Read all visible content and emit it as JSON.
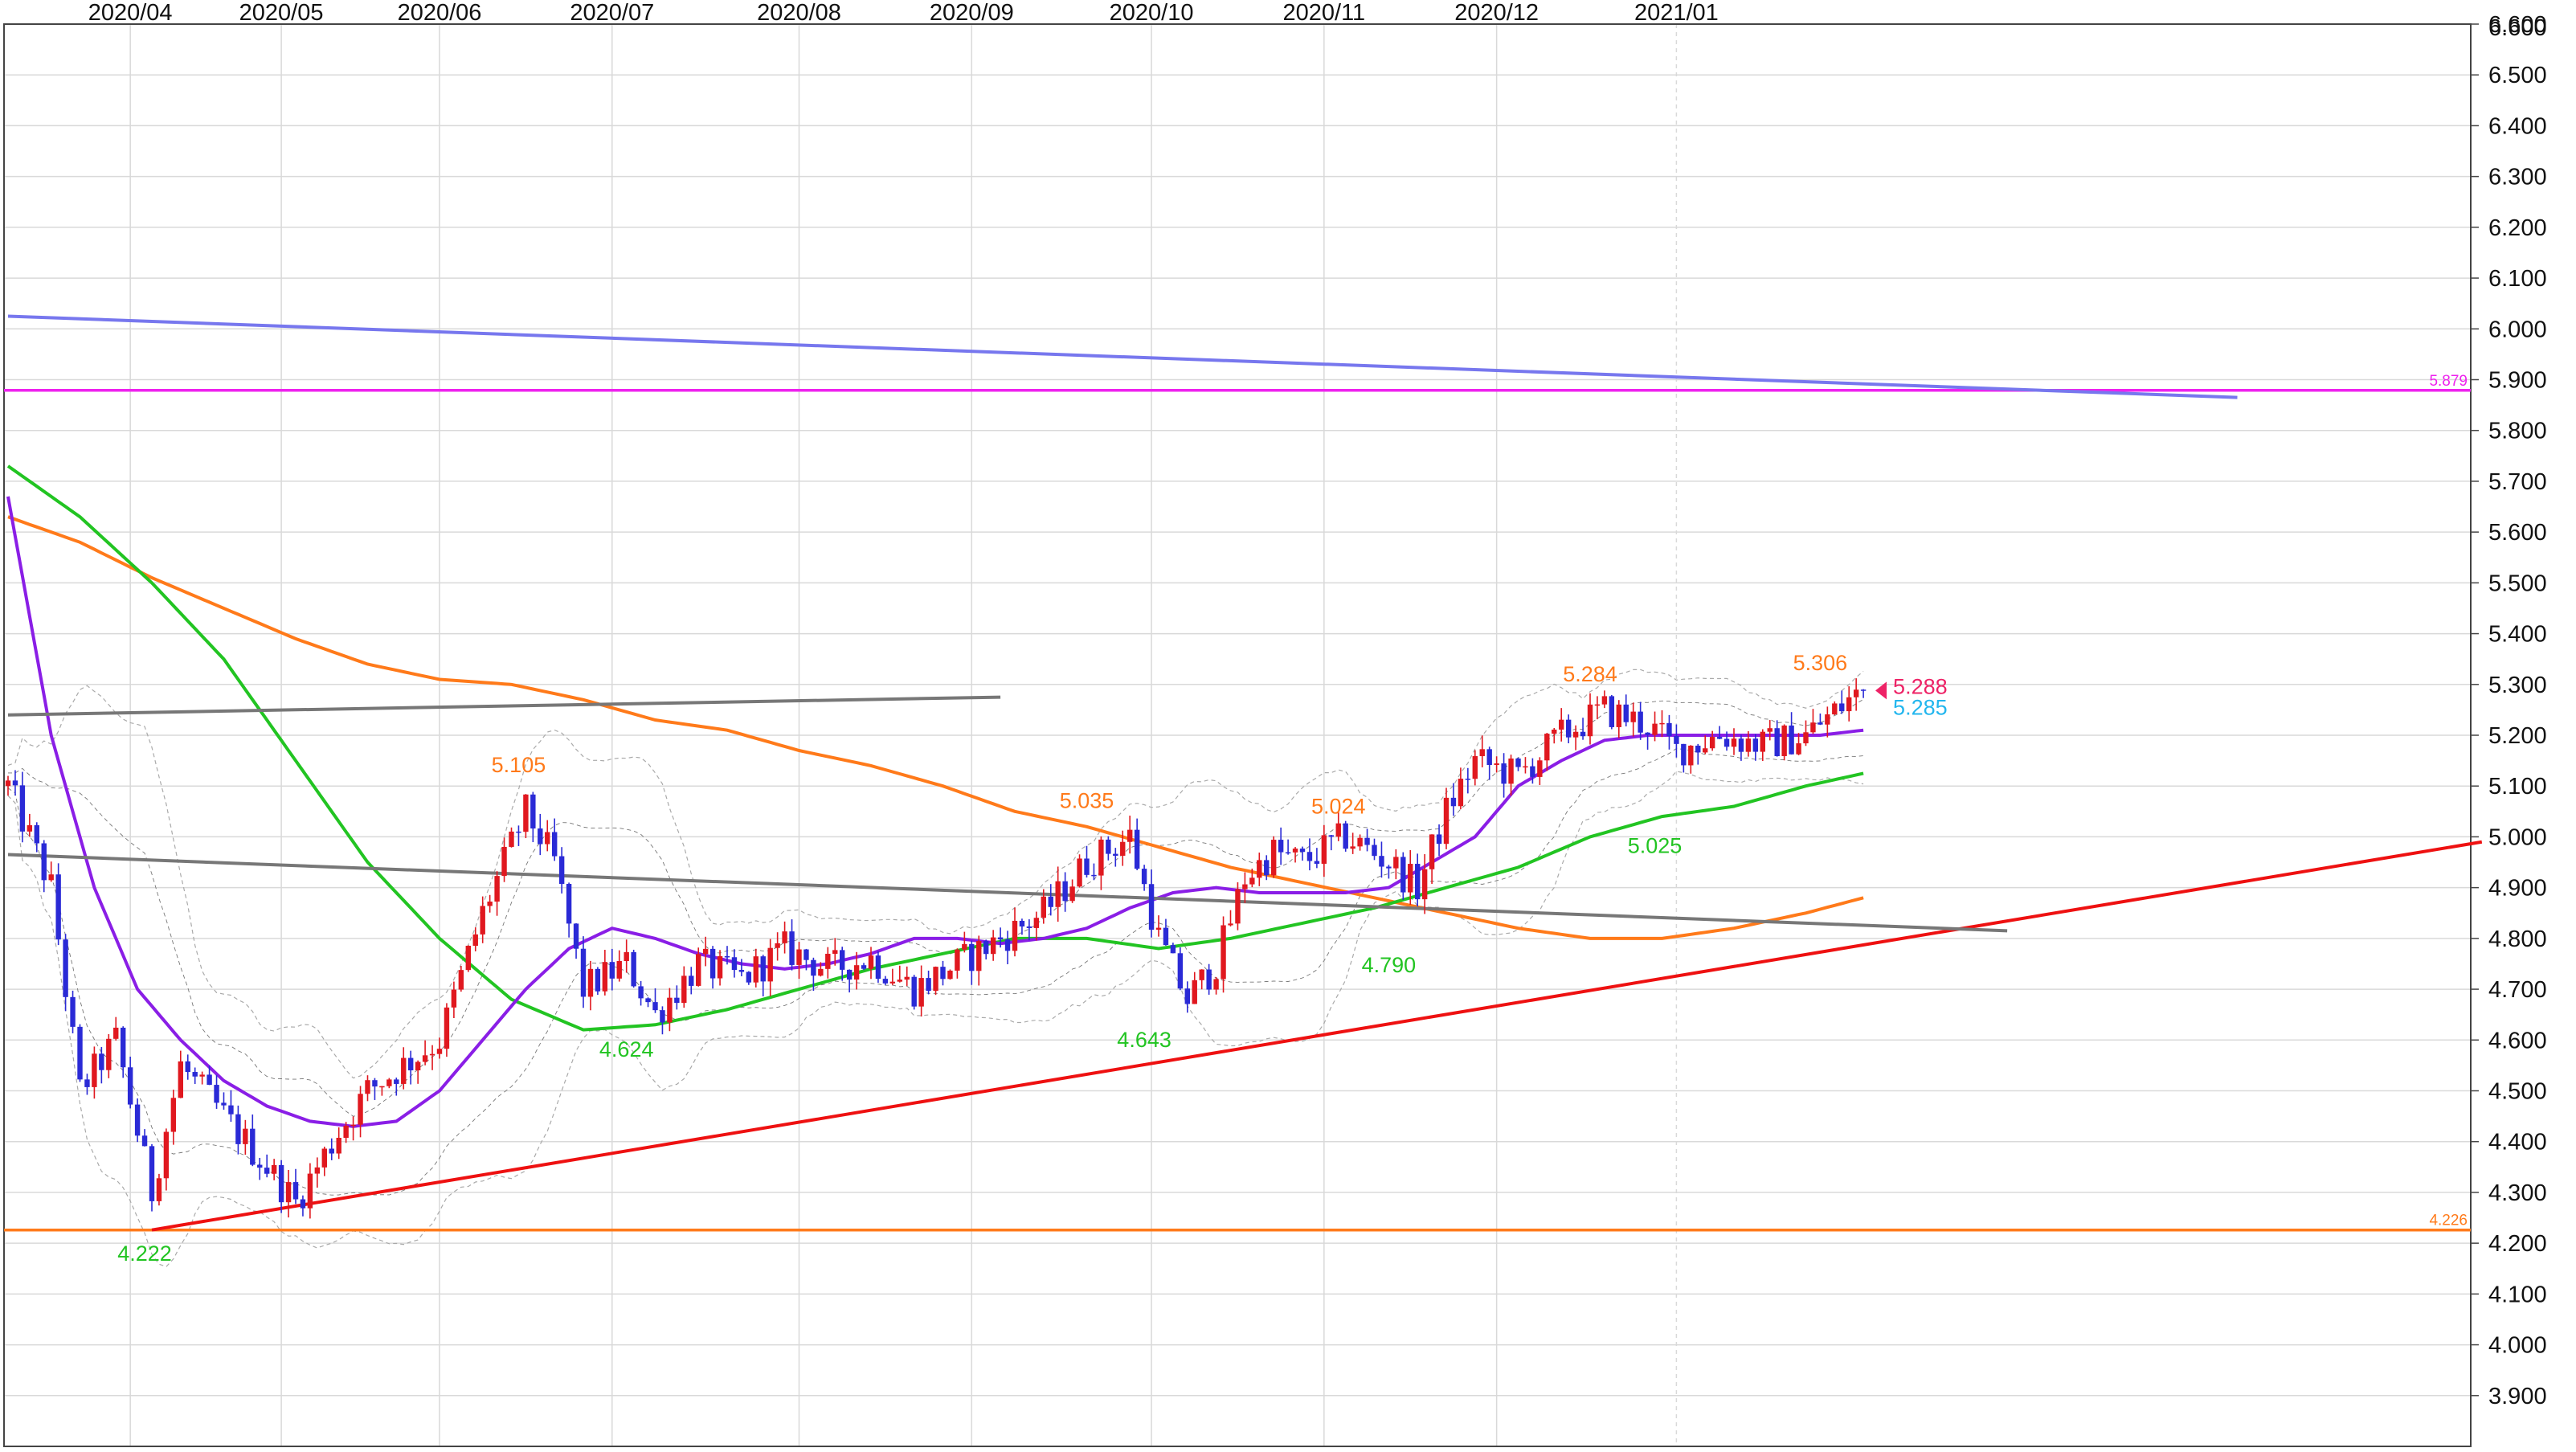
{
  "chart_data": {
    "type": "candlestick",
    "x_axis": {
      "ticks": [
        "2020/04",
        "2020/05",
        "2020/06",
        "2020/07",
        "2020/08",
        "2020/09",
        "2020/10",
        "2020/11",
        "2020/12",
        "2021/01"
      ]
    },
    "y_axis": {
      "range": [
        3.8,
        6.6
      ],
      "ticks": [
        "3.900",
        "4.000",
        "4.100",
        "4.200",
        "4.300",
        "4.400",
        "4.500",
        "4.600",
        "4.700",
        "4.800",
        "4.900",
        "5.000",
        "5.100",
        "5.200",
        "5.300",
        "5.400",
        "5.500",
        "5.600",
        "5.700",
        "5.800",
        "5.900",
        "6.000",
        "6.100",
        "6.200",
        "6.300",
        "6.400",
        "6.500",
        "6.600"
      ]
    },
    "grid": true,
    "colors": {
      "up_candle": "#e0181f",
      "down_candle": "#2a2ad6",
      "ma_short": "#8a1ee6",
      "ma_mid": "#22c422",
      "ma_long": "#ff7a1a",
      "uptrend_line": "#ee1111",
      "downtrend_line": "#7777ee",
      "resistance_line": "#ee22ee",
      "support_line": "#ff7a1a",
      "gray_line": "#777777",
      "last_price": "#ee2266",
      "current_ma": "#22b6ee"
    },
    "horizontal_lines": [
      {
        "value": 5.879,
        "label": "5.879",
        "color": "#ee22ee"
      },
      {
        "value": 4.226,
        "label": "4.226",
        "color": "#ff7a1a"
      }
    ],
    "trend_lines": [
      {
        "from": [
          0.0,
          6.025
        ],
        "to": [
          310.0,
          5.865
        ],
        "color": "#7777ee"
      },
      {
        "from": [
          20.0,
          4.226
        ],
        "to": [
          344.0,
          4.99
        ],
        "color": "#ee1111"
      },
      {
        "from": [
          0.0,
          5.24
        ],
        "to": [
          138.0,
          5.275
        ],
        "color": "#777777"
      },
      {
        "from": [
          0.0,
          4.965
        ],
        "to": [
          278.0,
          4.815
        ],
        "color": "#777777"
      }
    ],
    "ma_short": [
      [
        0,
        5.67
      ],
      [
        6,
        5.2
      ],
      [
        12,
        4.9
      ],
      [
        18,
        4.7
      ],
      [
        24,
        4.6
      ],
      [
        30,
        4.52
      ],
      [
        36,
        4.47
      ],
      [
        42,
        4.44
      ],
      [
        48,
        4.43
      ],
      [
        54,
        4.44
      ],
      [
        60,
        4.5
      ],
      [
        66,
        4.6
      ],
      [
        72,
        4.7
      ],
      [
        78,
        4.78
      ],
      [
        84,
        4.82
      ],
      [
        90,
        4.8
      ],
      [
        96,
        4.77
      ],
      [
        102,
        4.75
      ],
      [
        108,
        4.74
      ],
      [
        114,
        4.75
      ],
      [
        120,
        4.77
      ],
      [
        126,
        4.8
      ],
      [
        132,
        4.8
      ],
      [
        138,
        4.79
      ],
      [
        144,
        4.8
      ],
      [
        150,
        4.82
      ],
      [
        156,
        4.86
      ],
      [
        162,
        4.89
      ],
      [
        168,
        4.9
      ],
      [
        174,
        4.89
      ],
      [
        180,
        4.89
      ],
      [
        186,
        4.89
      ],
      [
        192,
        4.9
      ],
      [
        198,
        4.95
      ],
      [
        204,
        5.0
      ],
      [
        210,
        5.1
      ],
      [
        216,
        5.15
      ],
      [
        222,
        5.19
      ],
      [
        228,
        5.2
      ],
      [
        234,
        5.2
      ],
      [
        240,
        5.2
      ],
      [
        246,
        5.2
      ],
      [
        252,
        5.2
      ],
      [
        258,
        5.21
      ]
    ],
    "ma_mid": [
      [
        0,
        5.73
      ],
      [
        10,
        5.63
      ],
      [
        20,
        5.5
      ],
      [
        30,
        5.35
      ],
      [
        40,
        5.15
      ],
      [
        50,
        4.95
      ],
      [
        60,
        4.8
      ],
      [
        70,
        4.68
      ],
      [
        80,
        4.62
      ],
      [
        90,
        4.63
      ],
      [
        100,
        4.66
      ],
      [
        110,
        4.7
      ],
      [
        120,
        4.74
      ],
      [
        130,
        4.77
      ],
      [
        140,
        4.8
      ],
      [
        150,
        4.8
      ],
      [
        160,
        4.78
      ],
      [
        170,
        4.8
      ],
      [
        180,
        4.83
      ],
      [
        190,
        4.86
      ],
      [
        200,
        4.9
      ],
      [
        210,
        4.94
      ],
      [
        220,
        5.0
      ],
      [
        230,
        5.04
      ],
      [
        240,
        5.06
      ],
      [
        250,
        5.1
      ],
      [
        258,
        5.125
      ]
    ],
    "ma_long": [
      [
        0,
        5.63
      ],
      [
        10,
        5.58
      ],
      [
        20,
        5.51
      ],
      [
        30,
        5.45
      ],
      [
        40,
        5.39
      ],
      [
        50,
        5.34
      ],
      [
        60,
        5.31
      ],
      [
        70,
        5.3
      ],
      [
        80,
        5.27
      ],
      [
        90,
        5.23
      ],
      [
        100,
        5.21
      ],
      [
        110,
        5.17
      ],
      [
        120,
        5.14
      ],
      [
        130,
        5.1
      ],
      [
        140,
        5.05
      ],
      [
        150,
        5.02
      ],
      [
        160,
        4.98
      ],
      [
        170,
        4.94
      ],
      [
        180,
        4.91
      ],
      [
        190,
        4.88
      ],
      [
        200,
        4.85
      ],
      [
        210,
        4.82
      ],
      [
        220,
        4.8
      ],
      [
        230,
        4.8
      ],
      [
        240,
        4.82
      ],
      [
        250,
        4.85
      ],
      [
        258,
        4.88
      ]
    ],
    "price_path": [
      [
        0,
        5.1
      ],
      [
        6,
        4.9
      ],
      [
        10,
        4.5
      ],
      [
        15,
        4.6
      ],
      [
        20,
        4.3
      ],
      [
        24,
        4.55
      ],
      [
        30,
        4.45
      ],
      [
        36,
        4.35
      ],
      [
        40,
        4.28
      ],
      [
        46,
        4.42
      ],
      [
        50,
        4.5
      ],
      [
        55,
        4.55
      ],
      [
        60,
        4.6
      ],
      [
        66,
        4.85
      ],
      [
        72,
        5.05
      ],
      [
        76,
        4.95
      ],
      [
        80,
        4.7
      ],
      [
        86,
        4.75
      ],
      [
        90,
        4.65
      ],
      [
        96,
        4.75
      ],
      [
        102,
        4.72
      ],
      [
        108,
        4.78
      ],
      [
        114,
        4.74
      ],
      [
        120,
        4.76
      ],
      [
        126,
        4.7
      ],
      [
        132,
        4.75
      ],
      [
        138,
        4.8
      ],
      [
        144,
        4.85
      ],
      [
        150,
        4.95
      ],
      [
        156,
        5.0
      ],
      [
        160,
        4.8
      ],
      [
        164,
        4.68
      ],
      [
        168,
        4.75
      ],
      [
        172,
        4.92
      ],
      [
        176,
        4.97
      ],
      [
        180,
        4.95
      ],
      [
        186,
        5.0
      ],
      [
        192,
        4.95
      ],
      [
        196,
        4.9
      ],
      [
        200,
        5.05
      ],
      [
        204,
        5.15
      ],
      [
        210,
        5.12
      ],
      [
        216,
        5.2
      ],
      [
        222,
        5.25
      ],
      [
        228,
        5.22
      ],
      [
        232,
        5.17
      ],
      [
        238,
        5.2
      ],
      [
        244,
        5.18
      ],
      [
        250,
        5.2
      ],
      [
        256,
        5.27
      ],
      [
        258,
        5.288
      ]
    ],
    "high_low_labels": [
      {
        "text": "4.222",
        "x": 19.0,
        "y": 4.222,
        "kind": "low"
      },
      {
        "text": "5.105",
        "x": 71.0,
        "y": 5.105,
        "kind": "high"
      },
      {
        "text": "4.624",
        "x": 86.0,
        "y": 4.624,
        "kind": "low"
      },
      {
        "text": "5.035",
        "x": 150.0,
        "y": 5.035,
        "kind": "high"
      },
      {
        "text": "4.643",
        "x": 158.0,
        "y": 4.643,
        "kind": "low"
      },
      {
        "text": "5.024",
        "x": 185.0,
        "y": 5.024,
        "kind": "high"
      },
      {
        "text": "4.790",
        "x": 192.0,
        "y": 4.79,
        "kind": "low"
      },
      {
        "text": "5.284",
        "x": 220.0,
        "y": 5.284,
        "kind": "high"
      },
      {
        "text": "5.025",
        "x": 229.0,
        "y": 5.025,
        "kind": "low"
      },
      {
        "text": "5.306",
        "x": 252.0,
        "y": 5.306,
        "kind": "high"
      }
    ],
    "last_price": {
      "value": 5.288,
      "label": "5.288"
    },
    "current_ma": {
      "value": 5.285,
      "label": "5.285"
    }
  }
}
